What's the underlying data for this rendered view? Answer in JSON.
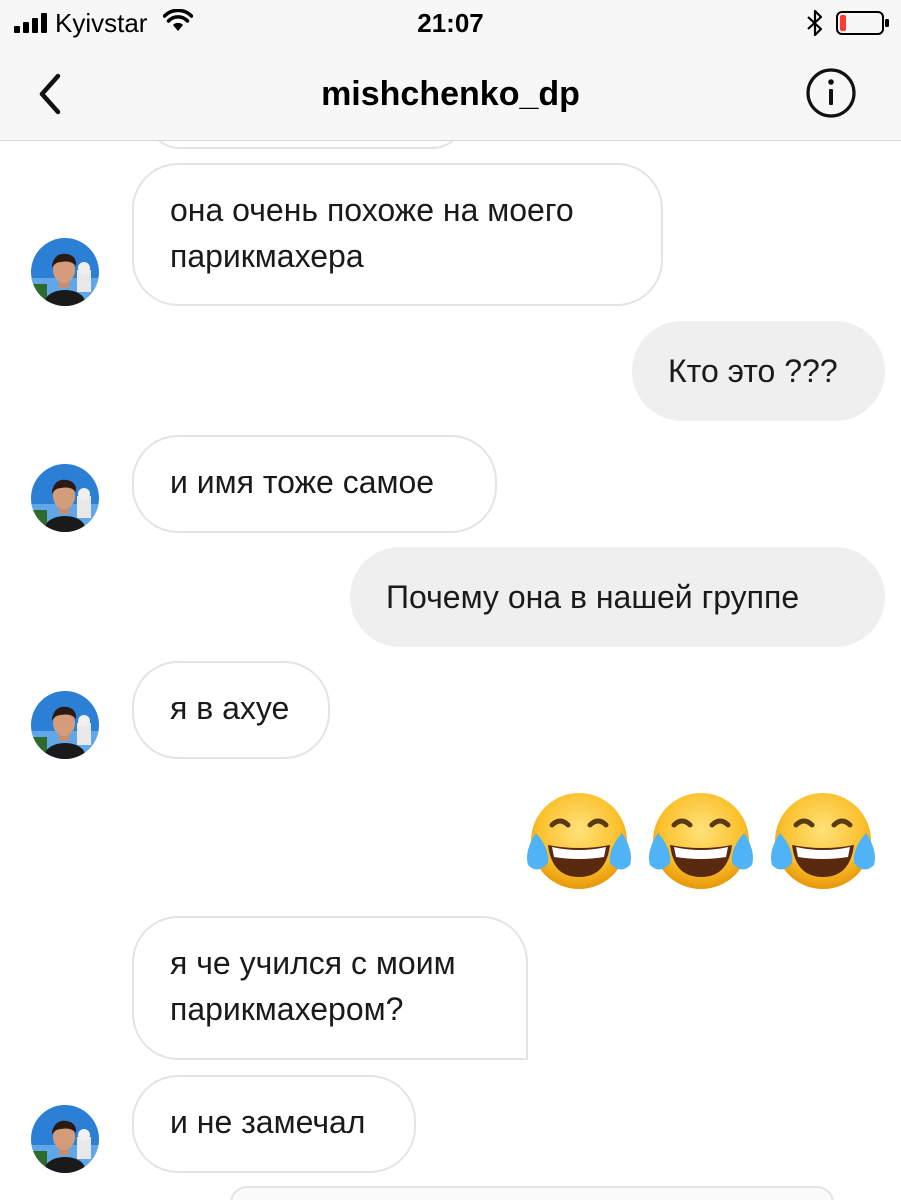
{
  "status_bar": {
    "carrier": "Kyivstar",
    "time": "21:07",
    "battery_color": "#ff3b30"
  },
  "header": {
    "title": "mishchenko_dp",
    "back_icon": "chevron-left-icon",
    "info_icon": "info-circle-icon"
  },
  "messages": [
    {
      "side": "in",
      "text_lines": [
        "она очень похоже на моего",
        "парикмахера"
      ]
    },
    {
      "side": "out",
      "text": "Кто это ???"
    },
    {
      "side": "in",
      "text": "и имя тоже самое"
    },
    {
      "side": "out",
      "text": "Почему она в нашей группе"
    },
    {
      "side": "in",
      "text": "я в ахуе"
    },
    {
      "side": "out",
      "emoji": "😂😂😂"
    },
    {
      "side": "in",
      "text_lines": [
        "я че учился с моим",
        "парикмахером?"
      ]
    },
    {
      "side": "in",
      "text": "и не замечал"
    }
  ],
  "colors": {
    "incoming_border": "#e4e4e4",
    "outgoing_fill": "#efefef",
    "bar_background": "#f7f7f7"
  }
}
